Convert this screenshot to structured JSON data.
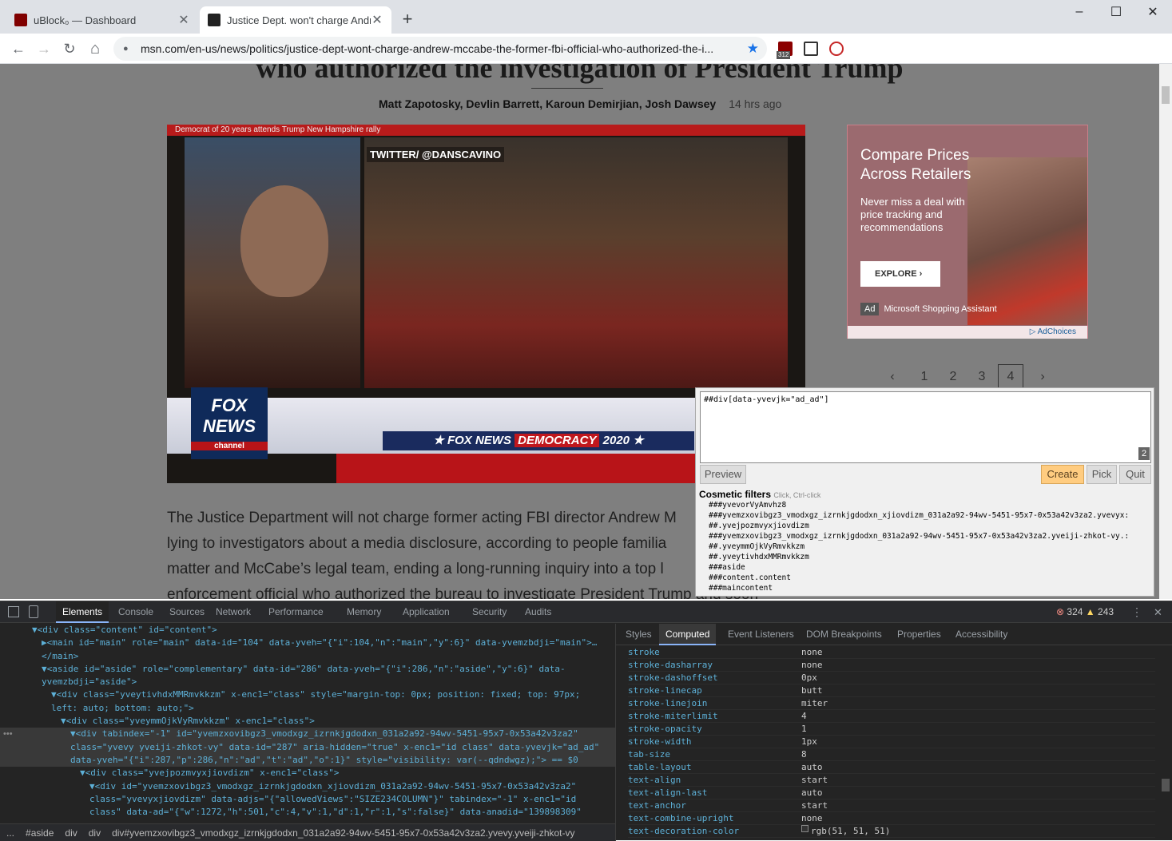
{
  "tabs": [
    {
      "title": "uBlock₀ — Dashboard",
      "active": false,
      "favicon_color": "#800000"
    },
    {
      "title": "Justice Dept. won't charge Andre",
      "active": true,
      "favicon_color": "#222222"
    }
  ],
  "new_tab_label": "+",
  "window": {
    "minimize": "–",
    "maximize": "☐",
    "close": "✕"
  },
  "toolbar": {
    "back": "←",
    "forward": "→",
    "reload": "↻",
    "home": "⌂",
    "lock_icon": "🔒",
    "url": "msn.com/en-us/news/politics/justice-dept-wont-charge-andrew-mccabe-the-former-fbi-official-who-authorized-the-i...",
    "star": "★",
    "ext_badge": "312"
  },
  "article": {
    "headline": "who authorized the investigation of President Trump",
    "authors": "Matt Zapotosky, Devlin Barrett, Karoun Demirjian, Josh Dawsey",
    "time": "14 hrs ago",
    "video_caption": "Democrat of 20 years attends Trump New Hampshire rally",
    "video_handle": "TWITTER/ @DANSCAVINO",
    "video_logo": "FOX NEWS",
    "video_logo_sub": "channel",
    "video_bar_left": "★ FOX NEWS",
    "video_bar_mid": "DEMOCRACY",
    "video_bar_right": "2020 ★",
    "body_lines": [
      "The Justice Department will not charge former acting FBI director Andrew M",
      "lying to investigators about a media disclosure, according to people familia",
      "matter and McCabe’s legal team, ending a long-running inquiry into a top l",
      "enforcement official who authorized the bureau to investigate President Trump and soon"
    ]
  },
  "ad": {
    "title_line1": "Compare Prices",
    "title_line2": "Across Retailers",
    "subtitle": "Never miss a deal with price tracking and recommendations",
    "cta": "EXPLORE  ›",
    "label": "Ad",
    "advertiser": "Microsoft Shopping Assistant",
    "adchoices": "▷ AdChoices"
  },
  "pagination": {
    "prev": "‹",
    "pages": [
      "1",
      "2",
      "3",
      "4"
    ],
    "current": "4",
    "next": "›"
  },
  "picker": {
    "filter_text": "##div[data-yvevjk=\"ad_ad\"]",
    "match_count": "2",
    "preview": "Preview",
    "create": "Create",
    "pick": "Pick",
    "quit": "Quit",
    "cosmetic_title": "Cosmetic filters",
    "cosmetic_hint": "Click, Ctrl-click",
    "filters": [
      "###yvevorVyAmvhz8",
      "###yvemzxovibgz3_vmodxgz_izrnkjgdodxn_xjiovdizm_031a2a92-94wv-5451-95x7-0x53a42v3za2.yvevyx:",
      "##.yvejpozmvyxjiovdizm",
      "###yvemzxovibgz3_vmodxgz_izrnkjgdodxn_031a2a92-94wv-5451-95x7-0x53a42v3za2.yveiji-zhkot-vy.:",
      "##.yveymmOjkVyRmvkkzm",
      "##.yveytivhdxMMRmvkkzm",
      "###aside",
      "###content.content",
      "###maincontent"
    ]
  },
  "devtools": {
    "tabs": [
      "Elements",
      "Console",
      "Sources",
      "Network",
      "Performance",
      "Memory",
      "Application",
      "Security",
      "Audits"
    ],
    "active_tab": "Elements",
    "errors": "324",
    "warnings": "243",
    "menu": "⋮",
    "close": "✕",
    "dom_lines": [
      {
        "indent": 40,
        "text": "▼<div class=\"content\" id=\"content\">",
        "sel": false
      },
      {
        "indent": 52,
        "text": "▶<main id=\"main\" role=\"main\" data-id=\"104\" data-yveh=\"{\"i\":104,\"n\":\"main\",\"y\":6}\" data-yvemzbdji=\"main\">…",
        "sel": false
      },
      {
        "indent": 52,
        "text": "</main>",
        "sel": false
      },
      {
        "indent": 52,
        "text": "▼<aside id=\"aside\" role=\"complementary\" data-id=\"286\" data-yveh=\"{\"i\":286,\"n\":\"aside\",\"y\":6}\" data-",
        "sel": false
      },
      {
        "indent": 52,
        "text": "yvemzbdji=\"aside\">",
        "sel": false
      },
      {
        "indent": 64,
        "text": "▼<div class=\"yveytivhdxMMRmvkkzm\" x-enc1=\"class\" style=\"margin-top: 0px; position: fixed; top: 97px;",
        "sel": false
      },
      {
        "indent": 64,
        "text": "left: auto; bottom: auto;\">",
        "sel": false
      },
      {
        "indent": 76,
        "text": "▼<div class=\"yveymmOjkVyRmvkkzm\" x-enc1=\"class\">",
        "sel": false
      },
      {
        "indent": 88,
        "text": "▼<div tabindex=\"-1\" id=\"yvemzxovibgz3_vmodxgz_izrnkjgdodxn_031a2a92-94wv-5451-95x7-0x53a42v3za2\"",
        "sel": true
      },
      {
        "indent": 88,
        "text": "class=\"yvevy yveiji-zhkot-vy\" data-id=\"287\" aria-hidden=\"true\" x-enc1=\"id class\" data-yvevjk=\"ad_ad\"",
        "sel": true
      },
      {
        "indent": 88,
        "text": "data-yveh=\"{\"i\":287,\"p\":286,\"n\":\"ad\",\"t\":\"ad\",\"o\":1}\" style=\"visibility: var(--qdndwgz);\"> == $0",
        "sel": true
      },
      {
        "indent": 100,
        "text": "▼<div class=\"yvejpozmvyxjiovdizm\" x-enc1=\"class\">",
        "sel": false
      },
      {
        "indent": 112,
        "text": "▼<div id=\"yvemzxovibgz3_vmodxgz_izrnkjgdodxn_xjiovdizm_031a2a92-94wv-5451-95x7-0x53a42v3za2\"",
        "sel": false
      },
      {
        "indent": 112,
        "text": "class=\"yvevyxjiovdizm\" data-adjs=\"{\"allowedViews\":\"SIZE234COLUMN\"}\" tabindex=\"-1\" x-enc1=\"id",
        "sel": false
      },
      {
        "indent": 112,
        "text": "class\" data-ad=\"{\"w\":1272,\"h\":501,\"c\":4,\"v\":1,\"d\":1,\"r\":1,\"s\":false}\" data-anadid=\"139898309\"",
        "sel": false
      }
    ],
    "breadcrumbs": [
      "...",
      "#aside",
      "div",
      "div",
      "div#yvemzxovibgz3_vmodxgz_izrnkjgdodxn_031a2a92-94wv-5451-95x7-0x53a42v3za2.yvevy.yveiji-zhkot-vy"
    ],
    "side_tabs": [
      "Styles",
      "Computed",
      "Event Listeners",
      "DOM Breakpoints",
      "Properties",
      "Accessibility"
    ],
    "side_active": "Computed",
    "computed": [
      {
        "name": "stroke",
        "value": "none"
      },
      {
        "name": "stroke-dasharray",
        "value": "none"
      },
      {
        "name": "stroke-dashoffset",
        "value": "0px"
      },
      {
        "name": "stroke-linecap",
        "value": "butt"
      },
      {
        "name": "stroke-linejoin",
        "value": "miter"
      },
      {
        "name": "stroke-miterlimit",
        "value": "4"
      },
      {
        "name": "stroke-opacity",
        "value": "1"
      },
      {
        "name": "stroke-width",
        "value": "1px"
      },
      {
        "name": "tab-size",
        "value": "8"
      },
      {
        "name": "table-layout",
        "value": "auto"
      },
      {
        "name": "text-align",
        "value": "start"
      },
      {
        "name": "text-align-last",
        "value": "auto"
      },
      {
        "name": "text-anchor",
        "value": "start"
      },
      {
        "name": "text-combine-upright",
        "value": "none"
      },
      {
        "name": "text-decoration-color",
        "value": "rgb(51, 51, 51)"
      }
    ]
  }
}
